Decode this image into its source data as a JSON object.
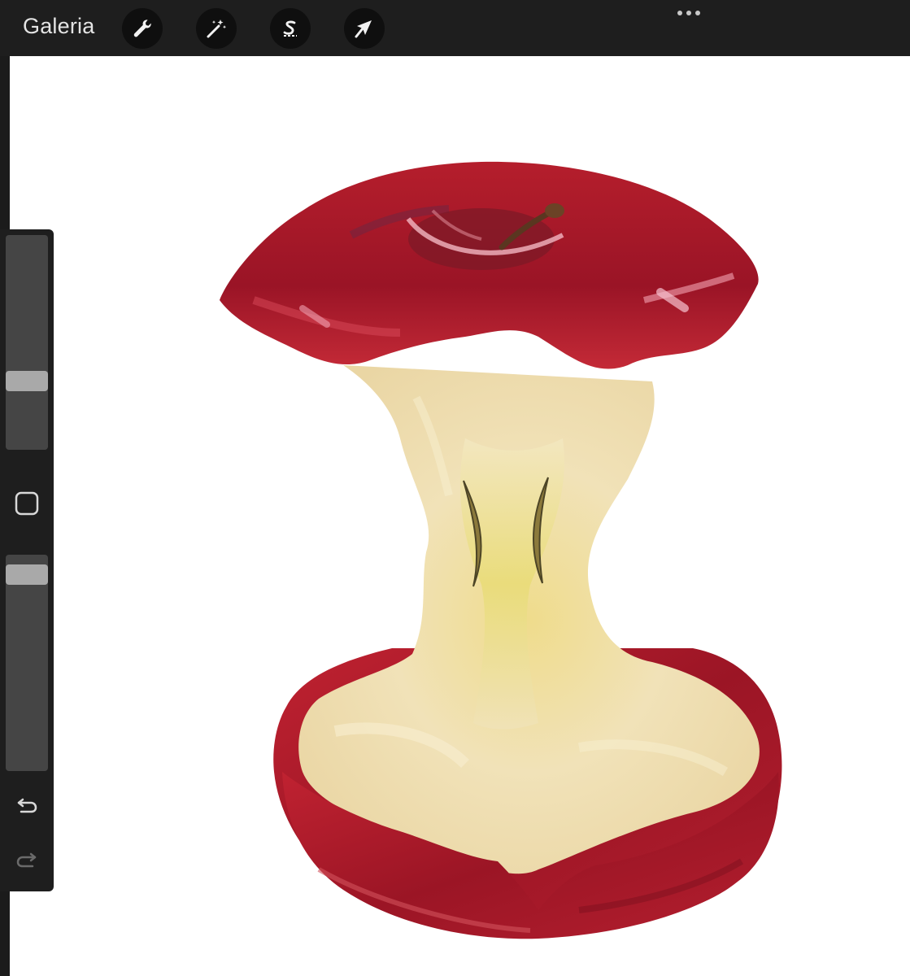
{
  "app": {
    "gallery_label": "Galeria"
  },
  "toolbar": {
    "actions": [
      {
        "name": "actions-menu",
        "icon": "wrench-icon"
      },
      {
        "name": "adjustments-menu",
        "icon": "magic-wand-icon"
      },
      {
        "name": "selection-tool",
        "icon": "selection-s-icon"
      },
      {
        "name": "transform-tool",
        "icon": "arrow-cursor-icon"
      }
    ],
    "more_icon": "ellipsis-icon"
  },
  "sidebar": {
    "brush_size_level": 0.3,
    "opacity_level": 0.95,
    "modify_icon": "rounded-square-icon",
    "undo_icon": "undo-arrow-icon",
    "redo_icon": "redo-arrow-icon"
  },
  "canvas": {
    "background_color": "#ffffff",
    "subject": "apple-core-painting",
    "colors": {
      "peel_red": "#a8182a",
      "flesh_cream": "#f1e1b6",
      "core_yellow": "#e8d870"
    }
  }
}
